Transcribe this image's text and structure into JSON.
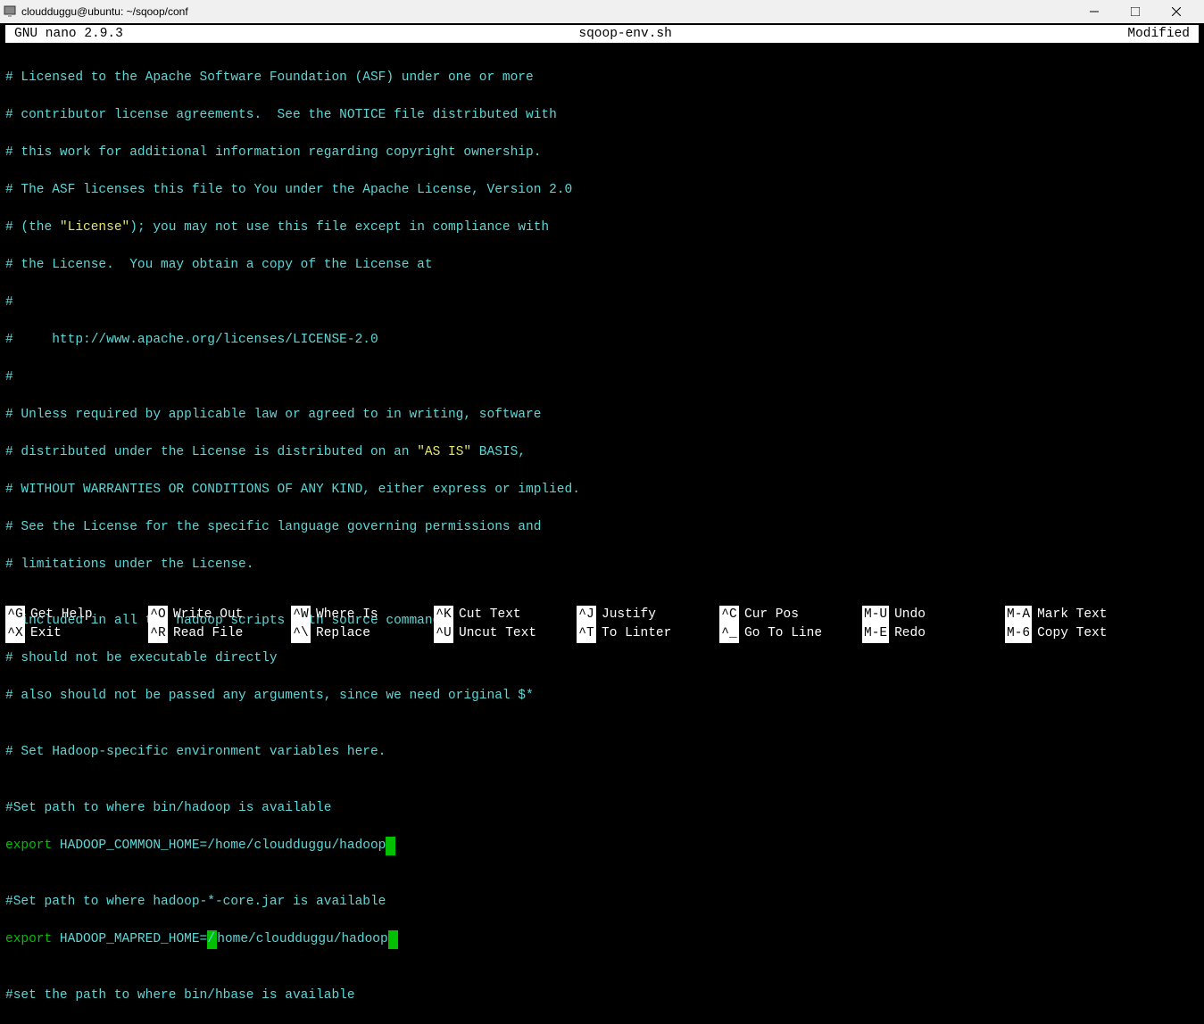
{
  "window": {
    "title": "cloudduggu@ubuntu: ~/sqoop/conf"
  },
  "statusbar": {
    "left": "  GNU nano 2.9.3",
    "center": "sqoop-env.sh",
    "right": "Modified "
  },
  "lines": {
    "l1": "# Licensed to the Apache Software Foundation (ASF) under one or more",
    "l2": "# contributor license agreements.  See the NOTICE file distributed with",
    "l3": "# this work for additional information regarding copyright ownership.",
    "l4": "# The ASF licenses this file to You under the Apache License, Version 2.0",
    "l5a": "# (the ",
    "l5b": "\"License\"",
    "l5c": "); you may not use this file except in compliance with",
    "l6": "# the License.  You may obtain a copy of the License at",
    "l7": "#",
    "l8": "#     http://www.apache.org/licenses/LICENSE-2.0",
    "l9": "#",
    "l10": "# Unless required by applicable law or agreed to in writing, software",
    "l11a": "# distributed under the License is distributed on an ",
    "l11b": "\"AS IS\"",
    "l11c": " BASIS,",
    "l12": "# WITHOUT WARRANTIES OR CONDITIONS OF ANY KIND, either express or implied.",
    "l13": "# See the License for the specific language governing permissions and",
    "l14": "# limitations under the License.",
    "l15": "",
    "l16": "# included in all the hadoop scripts with source command",
    "l17": "# should not be executable directly",
    "l18": "# also should not be passed any arguments, since we need original $*",
    "l19": "",
    "l20": "# Set Hadoop-specific environment variables here.",
    "l21": "",
    "l22": "#Set path to where bin/hadoop is available",
    "l23a": "export",
    "l23b": " HADOOP_COMMON_HOME=/home/cloudduggu/hadoop",
    "l24": "",
    "l25": "#Set path to where hadoop-*-core.jar is available",
    "l26a": "export",
    "l26b": " HADOOP_MAPRED_HOME=",
    "l26c": "/",
    "l26d": "home/cloudduggu/hadoop",
    "l27": "",
    "l28": "#set the path to where bin/hbase is available"
  },
  "menu": {
    "row1": [
      {
        "key": "^G",
        "label": "Get Help"
      },
      {
        "key": "^O",
        "label": "Write Out"
      },
      {
        "key": "^W",
        "label": "Where Is"
      },
      {
        "key": "^K",
        "label": "Cut Text"
      },
      {
        "key": "^J",
        "label": "Justify"
      },
      {
        "key": "^C",
        "label": "Cur Pos"
      },
      {
        "key": "M-U",
        "label": "Undo"
      },
      {
        "key": "M-A",
        "label": "Mark Text"
      }
    ],
    "row2": [
      {
        "key": "^X",
        "label": "Exit"
      },
      {
        "key": "^R",
        "label": "Read File"
      },
      {
        "key": "^\\",
        "label": "Replace"
      },
      {
        "key": "^U",
        "label": "Uncut Text"
      },
      {
        "key": "^T",
        "label": "To Linter"
      },
      {
        "key": "^_",
        "label": "Go To Line"
      },
      {
        "key": "M-E",
        "label": "Redo"
      },
      {
        "key": "M-6",
        "label": "Copy Text"
      }
    ]
  }
}
